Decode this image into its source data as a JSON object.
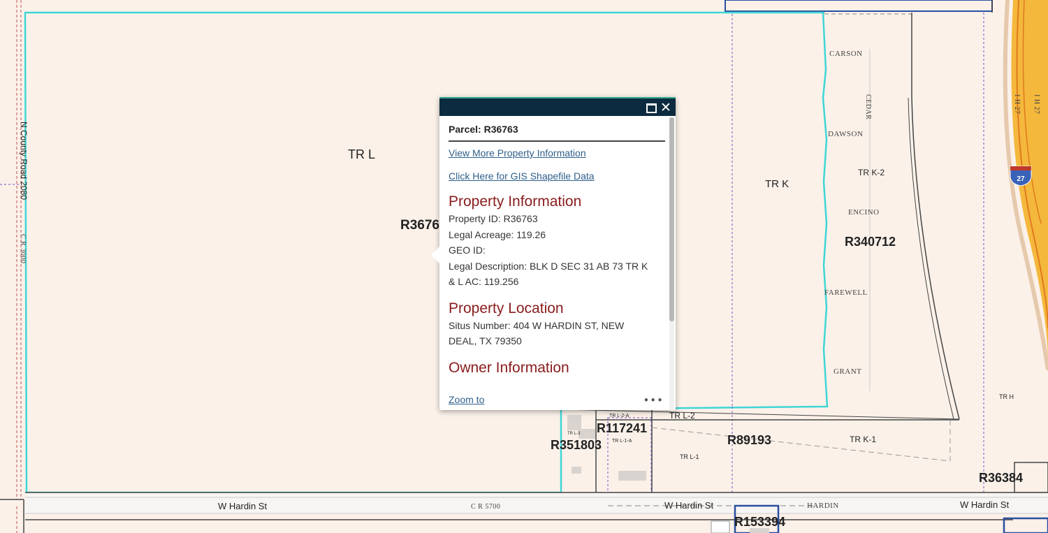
{
  "map": {
    "parcel_labels": {
      "tr_l": "TR L",
      "r3676": "R3676",
      "tr_k": "TR K",
      "tr_k2": "TR K-2",
      "r340712": "R340712",
      "tr_h": "TR H",
      "tr_l2a": "TR L-2-A",
      "r117241": "R117241",
      "tr_l2": "TR L-2",
      "tr_l3": "TR L-3",
      "tr_l1a": "TR L-1-A",
      "r351803": "R351803",
      "r89193": "R89193",
      "tr_k1": "TR K-1",
      "tr_l1": "TR L-1",
      "r36384": "R36384",
      "r153394": "R153394"
    },
    "street_labels": {
      "carson": "CARSON",
      "cedar": "CEDAR",
      "dawson": "DAWSON",
      "encino": "ENCINO",
      "farewell": "FAREWELL",
      "grant": "GRANT",
      "ih27_a": "I H 27",
      "ih27_b": "I H 27",
      "shield": "27",
      "county_road": "N County Road 2080",
      "cr3000": "C R 3000",
      "w_hardin_1": "W Hardin St",
      "cr5700": "C R 5700",
      "w_hardin_2": "W Hardin St",
      "hardin": "HARDIN",
      "w_hardin_3": "W Hardin St"
    }
  },
  "popup": {
    "parcel_title": "Parcel: R36763",
    "view_more_link": "View More Property Information",
    "gis_link": "Click Here for GIS Shapefile Data",
    "property_info": {
      "heading": "Property Information",
      "property_id": "Property ID: R36763",
      "legal_acreage": "Legal Acreage: 119.26",
      "geo_id": "GEO ID:",
      "legal_desc_1": "Legal Description: BLK D SEC 31 AB 73 TR K",
      "legal_desc_2": "& L AC: 119.256"
    },
    "property_location": {
      "heading": "Property Location",
      "situs_1": "Situs Number: 404 W HARDIN ST, NEW",
      "situs_2": "DEAL, TX 79350"
    },
    "owner_info": {
      "heading": "Owner Information"
    },
    "zoom_link": "Zoom to",
    "more_glyph": "•••",
    "close_glyph": "✕"
  }
}
